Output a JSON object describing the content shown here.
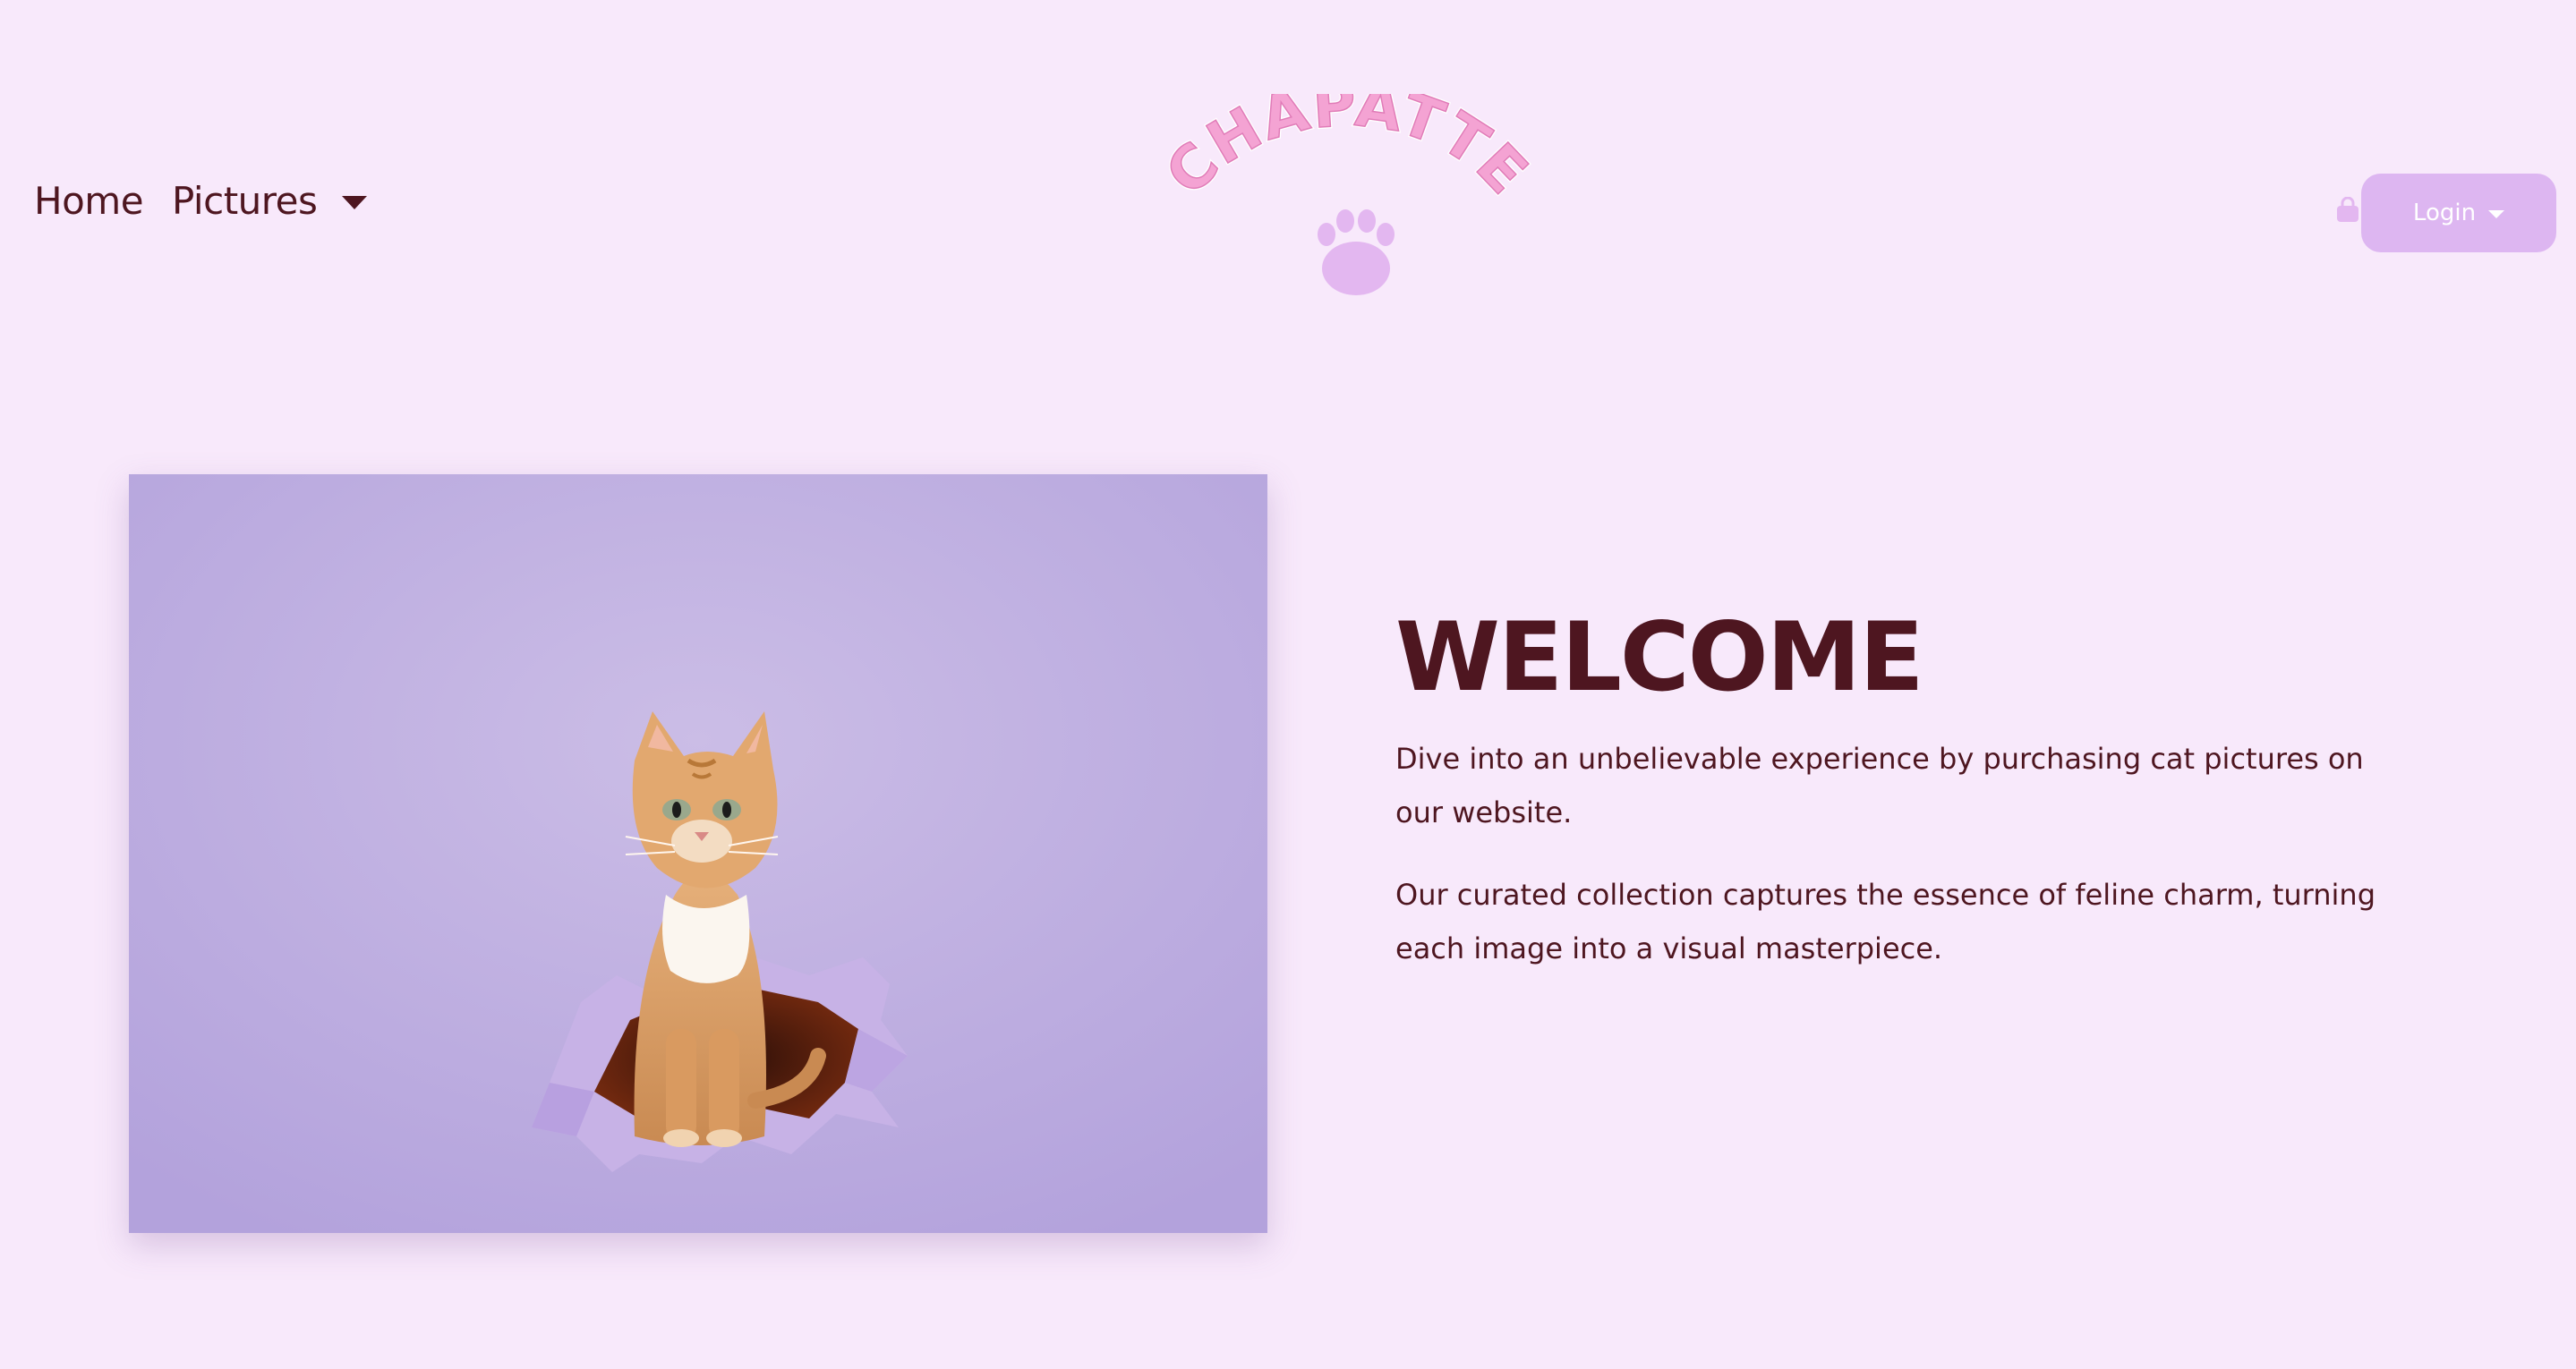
{
  "nav": {
    "home_label": "Home",
    "pictures_label": "Pictures"
  },
  "logo": {
    "text": "CHAPATTE"
  },
  "login": {
    "label": "Login"
  },
  "hero": {
    "image_alt": "",
    "title": "WELCOME",
    "paragraph_1": "Dive into an unbelievable experience by purchasing cat pictures on our website.",
    "paragraph_2": "Our curated collection captures the essence of feline charm, turning each image into a visual masterpiece."
  },
  "colors": {
    "background": "#f8e9fb",
    "text": "#4e1620",
    "accent": "#ddb6f1",
    "logo_pink": "#f4a3d3",
    "paw": "#e3b7f0"
  }
}
